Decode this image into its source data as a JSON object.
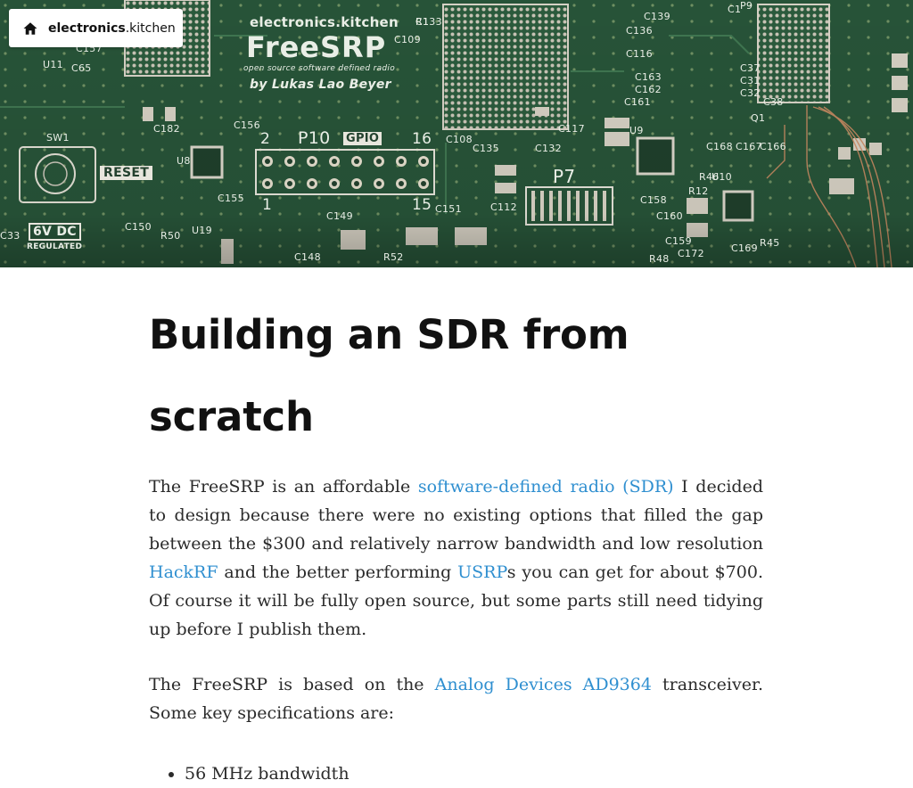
{
  "home_badge": {
    "icon": "home-icon",
    "brand_bold": "electronics",
    "brand_rest": ".kitchen"
  },
  "hero": {
    "image_alt_semantic": "pcb-photo",
    "colors": {
      "board": "#244f35",
      "silkscreen": "#e9eee6",
      "pad": "#c9c4b8",
      "trace": "#c98a62"
    },
    "silkscreen": {
      "site": "electronics.kitchen",
      "product": "FreeSRP",
      "tagline": "open source software defined radio",
      "author": "by Lukas Lao Beyer",
      "reset": "RESET",
      "power": "6V DC",
      "regulated": "REGULATED",
      "gpio": "GPIO",
      "p10": "P10",
      "p7": "P7",
      "pin2": "2",
      "pin16": "16",
      "pin1": "1",
      "pin15": "15",
      "sw1": "SW1",
      "labels": [
        "C133",
        "C139",
        "C136",
        "C116",
        "C163",
        "C162",
        "C161",
        "C109",
        "C156",
        "C155",
        "C149",
        "C151",
        "C108",
        "C112",
        "C135",
        "C132",
        "C117",
        "C158",
        "C160",
        "C159",
        "C172",
        "C169",
        "C167",
        "C166",
        "C168",
        "C148",
        "C150",
        "C182",
        "C157",
        "C65",
        "R12",
        "R46",
        "R45",
        "R48",
        "R50",
        "R52",
        "U8",
        "U9",
        "U10",
        "U11",
        "U19",
        "Q1",
        "C38",
        "C37",
        "C31",
        "C32",
        "C33",
        "P9",
        "C1",
        "R1"
      ]
    }
  },
  "article": {
    "title": "Building an SDR from scratch",
    "p1": {
      "t1": "The FreeSRP is an affordable ",
      "link1": "software-defined radio (SDR)",
      "t2": " I decided to design because there were no existing options that filled the gap between the $300 and relatively narrow bandwidth and low resolution ",
      "link2": "HackRF",
      "t3": " and the better performing ",
      "link3": "USRP",
      "t4": "s you can get for about $700. Of course it will be fully open source, but some parts still need tidying up before I publish them."
    },
    "p2": {
      "t1": "The FreeSRP is based on the ",
      "link1": "Analog Devices AD9364",
      "t2": " transceiver. Some key specifications are:"
    },
    "specs": [
      "56 MHz bandwidth"
    ]
  }
}
